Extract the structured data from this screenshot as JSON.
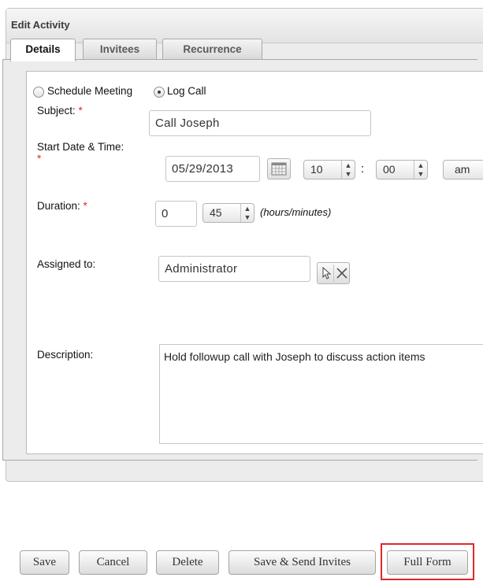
{
  "dialog": {
    "title": "Edit Activity"
  },
  "tabs": [
    {
      "label": "Details",
      "active": true
    },
    {
      "label": "Invitees",
      "active": false
    },
    {
      "label": "Recurrence",
      "active": false
    }
  ],
  "activity_type": {
    "options": [
      "Schedule Meeting",
      "Log Call"
    ],
    "selected": "Log Call"
  },
  "form": {
    "subject": {
      "label": "Subject:",
      "required_mark": "*",
      "value": "Call Joseph"
    },
    "start": {
      "label": "Start Date & Time:",
      "required_mark": "*",
      "date": "05/29/2013",
      "hour": "10",
      "separator": ":",
      "minute": "00",
      "meridiem": "am"
    },
    "duration": {
      "label": "Duration:",
      "required_mark": "*",
      "hours": "0",
      "minutes": "45",
      "hint": "(hours/minutes)"
    },
    "assigned": {
      "label": "Assigned to:",
      "value": "Administrator"
    },
    "description": {
      "label": "Description:",
      "value": "Hold followup call with Joseph to discuss action items"
    }
  },
  "buttons": {
    "save": "Save",
    "cancel": "Cancel",
    "delete": "Delete",
    "save_send": "Save & Send Invites",
    "full_form": "Full Form"
  },
  "colors": {
    "required": "#e0282a",
    "highlight": "#e0282a"
  },
  "icons": {
    "calendar": "calendar-icon",
    "select": "select-arrow-icon",
    "clear": "clear-x-icon",
    "stepper": "stepper-arrows-icon"
  }
}
